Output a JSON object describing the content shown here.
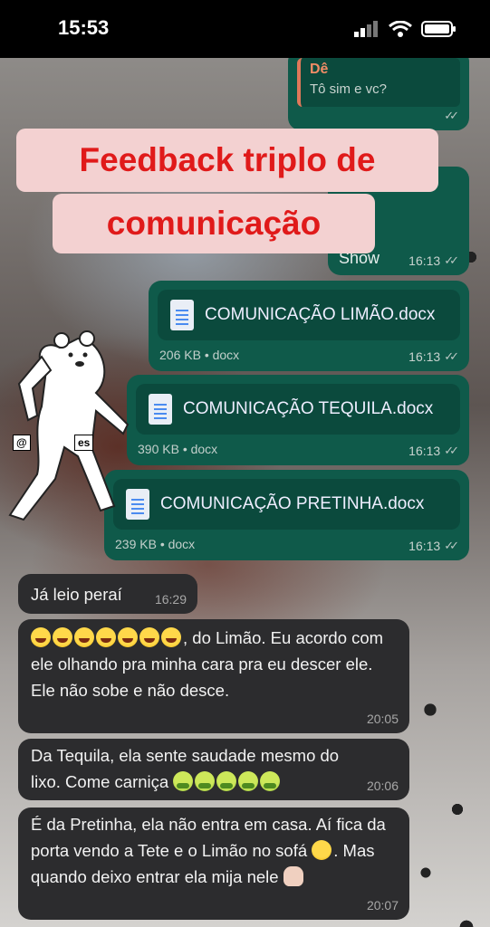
{
  "status_bar": {
    "time": "15:53"
  },
  "title_sticker": {
    "line1": "Feedback triplo de",
    "line2": "comunicação"
  },
  "sticker_handle": "@",
  "sticker_handle_tail": "es",
  "messages": {
    "reply": {
      "quoted_name": "Dê",
      "quoted_text": "Tô sim e vc?",
      "time": ""
    },
    "show": {
      "text": "Show",
      "time": "16:13"
    },
    "doc1": {
      "name": "COMUNICAÇÃO LIMÃO.docx",
      "size": "206 KB • docx",
      "time": "16:13"
    },
    "doc2": {
      "name": "COMUNICAÇÃO TEQUILA.docx",
      "size": "390 KB • docx",
      "time": "16:13"
    },
    "doc3": {
      "name": "COMUNICAÇÃO PRETINHA.docx",
      "size": "239 KB • docx",
      "time": "16:13"
    },
    "in1": {
      "text": "Já leio peraí",
      "time": "16:29"
    },
    "in2": {
      "text_after_emoji": ", do Limão. Eu",
      "text_rest": "acordo com ele olhando pra minha cara pra eu descer ele. Ele não sobe e não desce.",
      "time": "20:05"
    },
    "in3": {
      "text_line1": "Da Tequila, ela sente saudade mesmo do",
      "text_line2": "lixo. Come carniça",
      "time": "20:06"
    },
    "in4": {
      "text_a": "É da Pretinha, ela não entra em casa. Aí fica da porta vendo a Tete e o Limão no sofá",
      "text_b": ". Mas quando deixo entrar ela mija nele",
      "time": "20:07"
    }
  },
  "colors": {
    "outgoing": "#0f5a4a",
    "incoming": "#2c2c2e",
    "title_text": "#e01a1a",
    "title_bg": "#f3d1d1"
  }
}
